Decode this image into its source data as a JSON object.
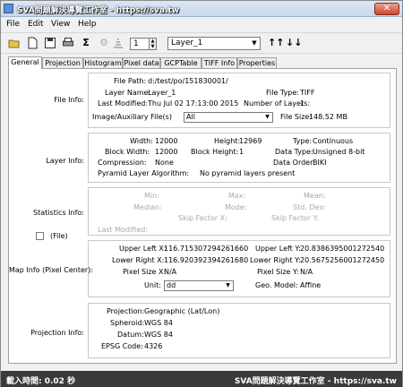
{
  "window": {
    "title": "SVA問題解決導覽工作室 - https://sva.tw",
    "close_label": "✕"
  },
  "menu": [
    "File",
    "Edit",
    "View",
    "Help"
  ],
  "toolbar": {
    "icons": [
      "open-folder-icon",
      "new-file-icon",
      "save-icon",
      "print-icon",
      "sigma-icon",
      "settings-icon",
      "layers-icon",
      "pyramid-icon"
    ],
    "layer_number": "1",
    "layer_select": "Layer_1",
    "sort_up_label": "↑↑",
    "sort_down_label": "↓↓"
  },
  "tabs": [
    "General",
    "Projection",
    "Histogram",
    "Pixel data",
    "GCPTable",
    "TIFF Info",
    "Properties"
  ],
  "active_tab": "General",
  "file_info": {
    "section": "File Info:",
    "file_path_label": "File Path:",
    "file_path": "d:/test/po/151830001/",
    "layer_name_label": "Layer Name:",
    "layer_name": "Layer_1",
    "file_type_label": "File Type:",
    "file_type": "TIFF",
    "last_modified_label": "Last Modified:",
    "last_modified": "Thu Jul 02 17:13:00 2015",
    "num_layers_label": "Number of Layers:",
    "num_layers": "1",
    "aux_label": "Image/Auxiliary File(s)",
    "aux_value": "All",
    "file_size_label": "File Size:",
    "file_size": "148.52 MB"
  },
  "layer_info": {
    "section": "Layer Info:",
    "width_label": "Width:",
    "width": "12000",
    "height_label": "Height:",
    "height": "12969",
    "type_label": "Type:",
    "type": "Continuous",
    "block_width_label": "Block Width:",
    "block_width": "12000",
    "block_height_label": "Block Height:",
    "block_height": "1",
    "data_type_label": "Data Type:",
    "data_type": "Unsigned 8-bit",
    "compression_label": "Compression:",
    "compression": "None",
    "data_order_label": "Data Order:",
    "data_order": "BIKI",
    "pyramid_label": "Pyramid Layer Algorithm:",
    "pyramid": "No pyramid layers present"
  },
  "statistics_info": {
    "section": "Statistics Info:",
    "min": "Min:",
    "max": "Max:",
    "mean": "Mean:",
    "median": "Median:",
    "mode": "Mode:",
    "std_dev": "Std. Dev:",
    "skip_x": "Skip Factor X:",
    "skip_y": "Skip Factor Y:",
    "last_modified": "Last Modified:",
    "file_checkbox_label": "(File)"
  },
  "map_info": {
    "section": "Map Info (Pixel Center):",
    "upper_left_x_label": "Upper Left X:",
    "upper_left_x": "116.715307294261660",
    "upper_left_y_label": "Upper Left Y:",
    "upper_left_y": "20.8386395001272540",
    "lower_right_x_label": "Lower Right X:",
    "lower_right_x": "116.920392394261680",
    "lower_right_y_label": "Lower Right Y:",
    "lower_right_y": "20.5675256001272450",
    "pixel_size_x_label": "Pixel Size X:",
    "pixel_size_x": "N/A",
    "pixel_size_y_label": "Pixel Size Y:",
    "pixel_size_y": "N/A",
    "unit_label": "Unit:",
    "unit": "dd",
    "geo_model_label": "Geo. Model:",
    "geo_model": "Affine"
  },
  "projection_info": {
    "section": "Projection Info:",
    "projection_label": "Projection:",
    "projection": "Geographic (Lat/Lon)",
    "spheroid_label": "Spheroid:",
    "spheroid": "WGS 84",
    "datum_label": "Datum:",
    "datum": "WGS 84",
    "epsg_label": "EPSG Code:",
    "epsg": "4326"
  },
  "statusbar": {
    "left": "載入時間: 0.02 秒",
    "right": "SVA問題解決導覽工作室 - https://sva.tw"
  }
}
